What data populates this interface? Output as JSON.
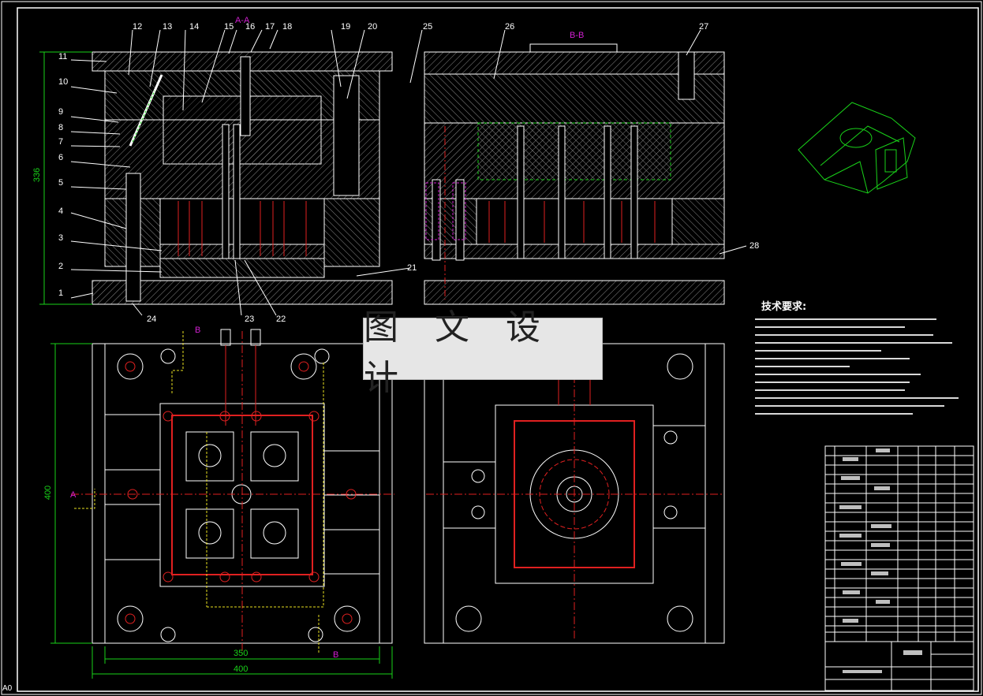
{
  "drawing": {
    "sheet_id": "A0",
    "watermark": "图 文 设 计",
    "tech_title": "技术要求:",
    "section_labels": {
      "aa": "A-A",
      "bb": "B-B",
      "cut_a": "A",
      "cut_b": "B"
    },
    "part_numbers": [
      "1",
      "2",
      "3",
      "4",
      "5",
      "6",
      "7",
      "8",
      "9",
      "10",
      "11",
      "12",
      "13",
      "14",
      "15",
      "16",
      "17",
      "18",
      "19",
      "20",
      "21",
      "22",
      "23",
      "24",
      "25",
      "26",
      "27",
      "28"
    ],
    "dimensions": {
      "height_side": "336",
      "height_plan": "400",
      "width_inner": "350",
      "width_outer": "400"
    },
    "colors": {
      "background": "#000000",
      "outline": "#ffffff",
      "hatch": "#8a8a8a",
      "centerline": "#e02020",
      "dimension": "#19d219",
      "section": "#d020d0",
      "hidden": "#e8e020",
      "watermark_bg": "#e6e6e6"
    }
  }
}
